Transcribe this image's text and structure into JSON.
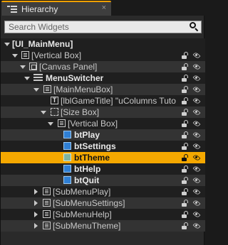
{
  "tab": {
    "title": "Hierarchy",
    "close": "×"
  },
  "search": {
    "placeholder": "Search Widgets",
    "value": ""
  },
  "tree": {
    "root": "[UI_MainMenu]",
    "vertical_box": "[Vertical Box]",
    "canvas_panel": "[Canvas Panel]",
    "menu_switcher": "MenuSwitcher",
    "main_menu_box": "[MainMenuBox]",
    "game_title": "[lblGameTitle] \"uColumns Tuto",
    "size_box": "[Size Box]",
    "inner_vertical_box": "[Vertical Box]",
    "bt_play": "btPlay",
    "bt_settings": "btSettings",
    "bt_theme": "btTheme",
    "bt_help": "btHelp",
    "bt_quit": "btQuit",
    "sub_menu_play": "[SubMenuPlay]",
    "sub_menu_settings": "[SubMenuSettings]",
    "sub_menu_help": "[SubMenuHelp]",
    "sub_menu_theme": "[SubMenuTheme]"
  },
  "colors": {
    "selection": "#f5a800",
    "tab_accent": "#f0a000",
    "button_icon": "#2f7fd4"
  }
}
